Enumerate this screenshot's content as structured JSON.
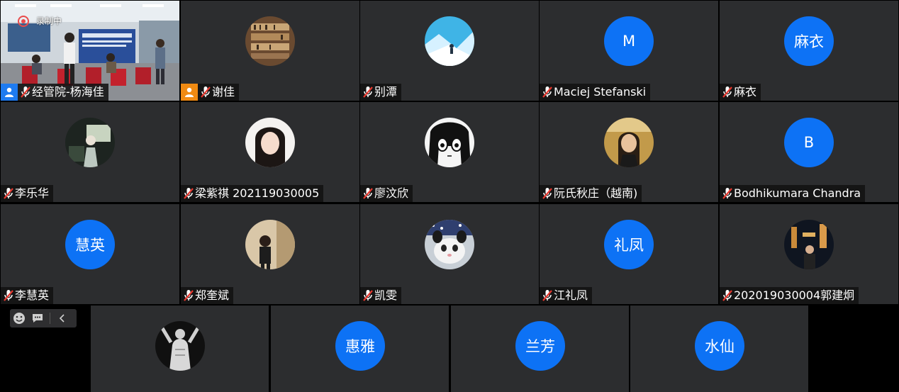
{
  "recording_label": "录制中",
  "colors": {
    "tile_bg": "#2c2d2f",
    "avatar_blue": "#0d72f5",
    "host_blue": "#1e7bf0",
    "cohost_orange": "#f08a12",
    "recording_red": "#e94b4b"
  },
  "participants": [
    {
      "name": "经管院-杨海佳",
      "avatar": "video",
      "host_badge": "blue"
    },
    {
      "name": "谢佳",
      "avatar": "photo-bookshelf",
      "host_badge": "orange"
    },
    {
      "name": "别潭",
      "avatar": "photo-winter"
    },
    {
      "name": "Maciej Stefanski",
      "initial": "M"
    },
    {
      "name": "麻衣",
      "initial": "麻衣"
    },
    {
      "name": "李乐华",
      "avatar": "photo-dark"
    },
    {
      "name": "梁紫祺 202119030005",
      "avatar": "photo-girl"
    },
    {
      "name": "廖汶欣",
      "avatar": "photo-anime"
    },
    {
      "name": "阮氏秋庄（越南)",
      "avatar": "photo-warm"
    },
    {
      "name": "Bodhikumara Chandra",
      "initial": "B"
    },
    {
      "name": "李慧英",
      "initial": "慧英"
    },
    {
      "name": "郑奎斌",
      "avatar": "photo-room"
    },
    {
      "name": "凯雯",
      "avatar": "photo-cat"
    },
    {
      "name": "江礼凤",
      "initial": "礼凤"
    },
    {
      "name": "202019030004郭建炯",
      "avatar": "photo-night"
    }
  ],
  "bottom_participants": [
    {
      "avatar": "photo-silhouette"
    },
    {
      "initial": "惠雅"
    },
    {
      "initial": "兰芳"
    },
    {
      "initial": "水仙"
    }
  ],
  "toolbar": {
    "icons": [
      "emoji-icon",
      "chat-icon",
      "collapse-chevron-icon"
    ]
  }
}
